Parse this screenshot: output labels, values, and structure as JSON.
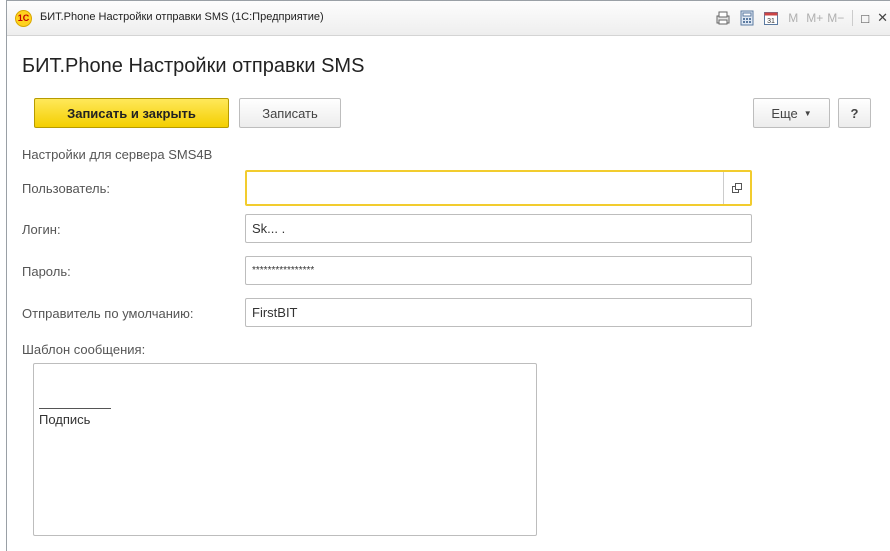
{
  "window": {
    "title": "БИТ.Phone Настройки отправки SMS  (1С:Предприятие)",
    "app_icon_text": "1С",
    "toolbar_m": [
      "M",
      "M+",
      "M−"
    ],
    "maximize_glyph": "□",
    "close_glyph": "✕"
  },
  "form": {
    "heading": "БИТ.Phone Настройки отправки SMS",
    "buttons": {
      "save_close": "Записать и закрыть",
      "save": "Записать",
      "more": "Еще",
      "help": "?"
    },
    "server_caption": "Настройки для сервера SMS4B",
    "fields": {
      "user": {
        "label": "Пользователь:",
        "value": ""
      },
      "login": {
        "label": "Логин:",
        "value": "Sk... ."
      },
      "password": {
        "label": "Пароль:",
        "value": "****************"
      },
      "sender": {
        "label": "Отправитель по умолчанию:",
        "value": "FirstBIT"
      }
    },
    "template": {
      "label": "Шаблон сообщения:",
      "signature": "Подпись"
    }
  },
  "colors": {
    "primary_button": "#f4cf00",
    "focus_border": "#f2cc2e"
  }
}
